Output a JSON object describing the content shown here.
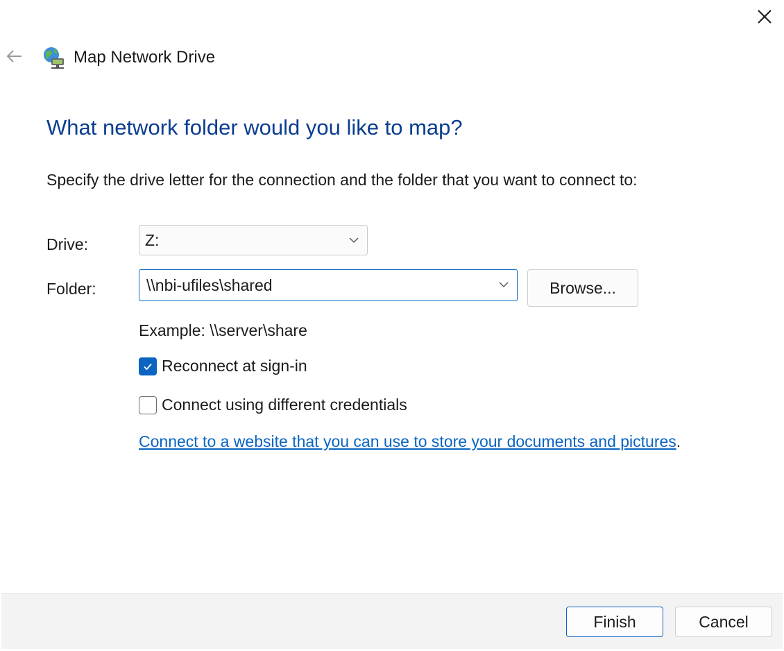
{
  "window": {
    "title": "Map Network Drive",
    "close_icon": "close-icon",
    "back_icon": "back-arrow-icon",
    "app_icon": "network-drive-icon"
  },
  "main": {
    "heading": "What network folder would you like to map?",
    "instruction": "Specify the drive letter for the connection and the folder that you want to connect to:",
    "drive": {
      "label": "Drive:",
      "value": "Z:"
    },
    "folder": {
      "label": "Folder:",
      "value": "\\\\nbi-ufiles\\shared"
    },
    "browse_label": "Browse...",
    "example": "Example: \\\\server\\share",
    "reconnect": {
      "label": "Reconnect at sign-in",
      "checked": true
    },
    "credentials": {
      "label": "Connect using different credentials",
      "checked": false
    },
    "link_text": "Connect to a website that you can use to store your documents and pictures",
    "link_suffix": "."
  },
  "footer": {
    "finish_label": "Finish",
    "cancel_label": "Cancel"
  },
  "colors": {
    "heading": "#0b3d91",
    "accent": "#0a64c2",
    "footer_bg": "#f3f3f3"
  }
}
